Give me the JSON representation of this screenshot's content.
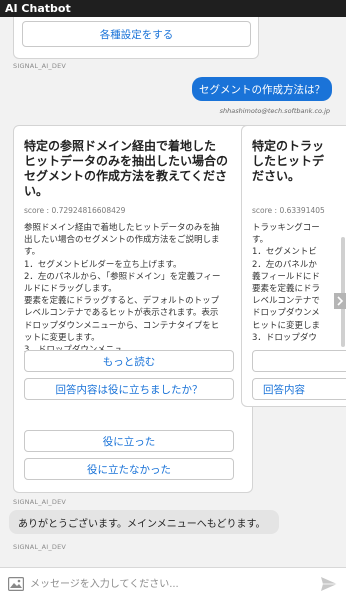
{
  "app": {
    "title": "AI Chatbot"
  },
  "top_message": {
    "button_label": "各種設定をする",
    "sender": "SIGNAL_AI_DEV"
  },
  "user_message": {
    "text": "セグメントの作成方法は？",
    "email": "shhashimoto@tech.softbank.co.jp"
  },
  "cards": [
    {
      "title_lines": [
        "特定の参照ドメイン経由で着地した",
        "ヒットデータのみを抽出したい場合の",
        "セグメントの作成方法を教えてくださ",
        "い。"
      ],
      "score": "score : 0.72924816608429",
      "body_lines": [
        "参照ドメイン経由で着地したヒットデータのみを抽",
        "出したい場合のセグメントの作成方法をご説明しま",
        "す。",
        "1．セグメントビルダーを立ち上げます。",
        "2．左のパネルから、「参照ドメイン」を定義フィー",
        "ルドにドラッグします。",
        "要素を定義にドラッグすると、デフォルトのトップ",
        "レベルコンテナであるヒットが表示されます。表示",
        "ドロップダウンメニューから、コンテナタイプをヒ",
        "ットに変更します。",
        "3．ドロップダウンメニュ…"
      ],
      "read_more": "もっと読む",
      "feedback_question": "回答内容は役に立ちましたか？",
      "helpful": "役に立った",
      "not_helpful": "役に立たなかった"
    },
    {
      "title_lines": [
        "特定のトラッ",
        "したヒットデ",
        "ださい。"
      ],
      "score": "score : 0.63391405",
      "body_lines": [
        "トラッキングコー",
        "す。",
        "1．セグメントビ",
        "2．左のパネルか",
        "義フィールドにド",
        "要素を定義にドラ",
        "レベルコンテナで",
        "ドロップダウンメ",
        "ヒットに変更しま",
        "3．ドロップダウ"
      ],
      "feedback_question": "回答内容"
    }
  ],
  "carousel": {
    "next_icon": "chevron-right-icon"
  },
  "bot_reply": {
    "sender": "SIGNAL_AI_DEV",
    "text": "ありがとうございます。メインメニューへもどります。",
    "sender_bottom": "SIGNAL_AI_DEV"
  },
  "composer": {
    "placeholder": "メッセージを入力してください...",
    "attach_icon": "image-icon",
    "send_icon": "send-icon"
  },
  "colors": {
    "accent": "#1a73d8",
    "titlebar": "#1f1f1f",
    "chat_bg": "#f2f2f2",
    "bot_bubble": "#e4e4e4"
  }
}
